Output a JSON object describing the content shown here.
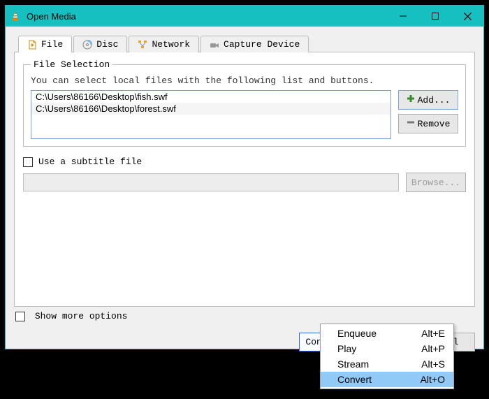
{
  "titlebar": {
    "title": "Open Media"
  },
  "tabs": {
    "file": "File",
    "disc": "Disc",
    "network": "Network",
    "capture": "Capture Device"
  },
  "selection": {
    "legend": "File Selection",
    "hint": "You can select local files with the following list and buttons.",
    "files": [
      "C:\\Users\\86166\\Desktop\\fish.swf",
      "C:\\Users\\86166\\Desktop\\forest.swf"
    ],
    "add": "Add...",
    "remove": "Remove"
  },
  "subtitle": {
    "checkbox_label": "Use a subtitle file",
    "browse": "Browse..."
  },
  "more": {
    "label": "Show more options"
  },
  "actions": {
    "convert_save": "Convert / Save",
    "cancel": "Cancel"
  },
  "menu": {
    "items": [
      {
        "label": "Enqueue",
        "accel": "Alt+E"
      },
      {
        "label": "Play",
        "accel": "Alt+P"
      },
      {
        "label": "Stream",
        "accel": "Alt+S"
      },
      {
        "label": "Convert",
        "accel": "Alt+O"
      }
    ],
    "highlighted_index": 3
  }
}
